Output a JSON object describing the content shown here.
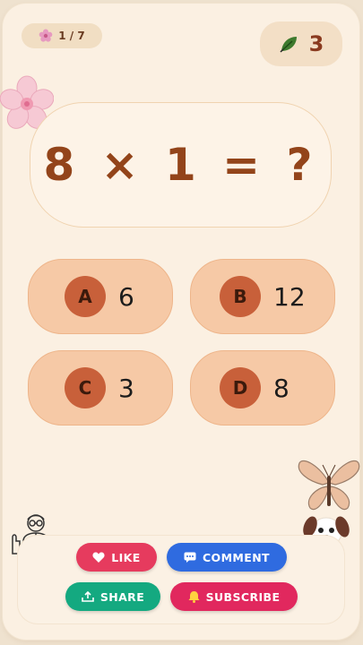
{
  "level": {
    "icon": "flower-icon",
    "text": "1 / 7"
  },
  "score": {
    "icon": "leaf-icon",
    "value": "3"
  },
  "question": {
    "text": "8 × 1 = ?"
  },
  "answers": [
    {
      "letter": "A",
      "value": "6"
    },
    {
      "letter": "B",
      "value": "12"
    },
    {
      "letter": "C",
      "value": "3"
    },
    {
      "letter": "D",
      "value": "8"
    }
  ],
  "social": {
    "like": "LIKE",
    "comment": "COMMENT",
    "share": "SHARE",
    "subscribe": "SUBSCRIBE"
  },
  "colors": {
    "answer_bg": "#f6c9a6",
    "letter_badge": "#c8603a",
    "question_text": "#93441a",
    "like": "#e63b5e",
    "comment": "#2f6be0",
    "share": "#14a980",
    "subscribe": "#e1285e"
  }
}
